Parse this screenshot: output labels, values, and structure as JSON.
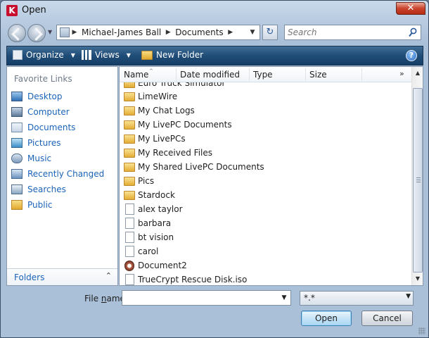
{
  "window": {
    "title": "Open",
    "app_icon_letter": "K",
    "close_label": "✕"
  },
  "address": {
    "crumbs": [
      "Michael-James Ball",
      "Documents"
    ],
    "separator": "▶",
    "dropdown": "▼",
    "refresh": "↻"
  },
  "search": {
    "placeholder": "Search"
  },
  "toolbar": {
    "organize_label": "Organize",
    "views_label": "Views",
    "new_folder_label": "New Folder",
    "caret": "▼",
    "help": "?"
  },
  "favorites": {
    "title": "Favorite Links",
    "items": [
      {
        "label": "Desktop",
        "icon": "desktop-icon"
      },
      {
        "label": "Computer",
        "icon": "computer-icon"
      },
      {
        "label": "Documents",
        "icon": "documents-icon"
      },
      {
        "label": "Pictures",
        "icon": "pictures-icon"
      },
      {
        "label": "Music",
        "icon": "music-icon"
      },
      {
        "label": "Recently Changed",
        "icon": "recent-icon"
      },
      {
        "label": "Searches",
        "icon": "searches-icon"
      },
      {
        "label": "Public",
        "icon": "folder-icon"
      }
    ],
    "folders_label": "Folders",
    "folders_chevron": "⌃"
  },
  "columns": [
    "Name",
    "Date modified",
    "Type",
    "Size"
  ],
  "more_columns": "»",
  "files": [
    {
      "name": "Euro Truck Simulator",
      "kind": "folder"
    },
    {
      "name": "LimeWire",
      "kind": "folder"
    },
    {
      "name": "My Chat Logs",
      "kind": "folder"
    },
    {
      "name": "My LivePC Documents",
      "kind": "folder"
    },
    {
      "name": "My LivePCs",
      "kind": "folder"
    },
    {
      "name": "My Received Files",
      "kind": "folder"
    },
    {
      "name": "My Shared LivePC Documents",
      "kind": "folder"
    },
    {
      "name": "Pics",
      "kind": "folder"
    },
    {
      "name": "Stardock",
      "kind": "folder"
    },
    {
      "name": "alex taylor",
      "kind": "file"
    },
    {
      "name": "barbara",
      "kind": "file"
    },
    {
      "name": "bt vision",
      "kind": "file"
    },
    {
      "name": "carol",
      "kind": "file"
    },
    {
      "name": "Document2",
      "kind": "doc"
    },
    {
      "name": "TrueCrypt Rescue Disk.iso",
      "kind": "file"
    }
  ],
  "bottom": {
    "file_name_label_prefix": "File ",
    "file_name_label_u": "n",
    "file_name_label_suffix": "ame:",
    "file_name_value": "",
    "filter_value": "*.*",
    "open_label": "Open",
    "cancel_label": "Cancel"
  },
  "colors": {
    "command_bar": "#1f4d78",
    "link": "#1b63b8",
    "close": "#c9432d"
  }
}
